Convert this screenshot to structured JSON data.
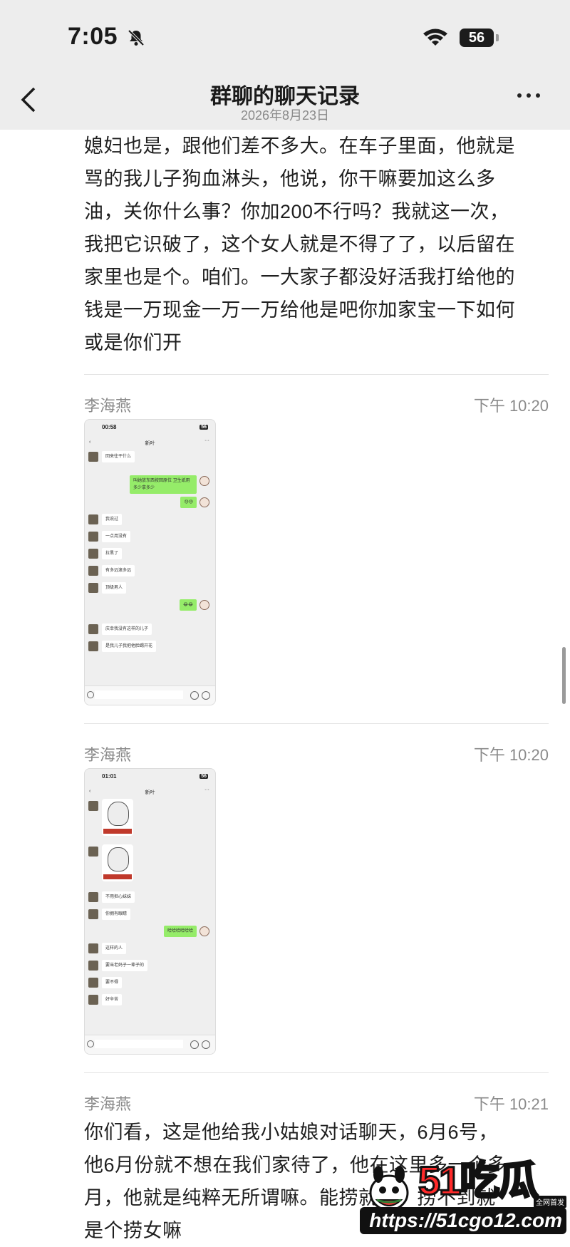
{
  "status": {
    "time": "7:05",
    "battery": "56"
  },
  "nav": {
    "title": "群聊的聊天记录",
    "date": "2026年8月23日"
  },
  "messages": [
    {
      "text_lines": [
        "媳妇也是，跟他们差不多大。在车子里面，他就是",
        "骂的我儿子狗血淋头，他说，你干嘛要加这么多",
        "油，关你什么事？你加200不行吗？我就这一次，",
        "我把它识破了，这个女人就是不得了了，以后留在",
        "家里也是个。咱们。一大家子都没好活我打给他的",
        "钱是一万现金一万一万给他是吧你加家宝一下如何",
        "或是你们开"
      ]
    },
    {
      "sender": "李海燕",
      "time": "下午 10:20",
      "shot": {
        "time": "00:58",
        "title": "新叶",
        "bubbles": [
          {
            "side": "l",
            "text": "回来往干什么"
          },
          {
            "side": "r",
            "text": "叫她放东西按回原位 卫生纸用多少拿多少"
          },
          {
            "side": "r",
            "text": "😓😓"
          },
          {
            "side": "l",
            "text": "我说过"
          },
          {
            "side": "l",
            "text": "一点用没有"
          },
          {
            "side": "l",
            "text": "拉黑了"
          },
          {
            "side": "l",
            "text": "有多远滚多远"
          },
          {
            "side": "l",
            "text": "顶级男人"
          },
          {
            "side": "r",
            "text": "😂😂"
          },
          {
            "side": "l",
            "text": "庆幸我没有这样的儿子"
          },
          {
            "side": "l",
            "text": "是我儿子我把他脸踢开花"
          }
        ]
      }
    },
    {
      "sender": "李海燕",
      "time": "下午 10:20",
      "shot": {
        "time": "01:01",
        "title": "新叶",
        "bubbles": [
          {
            "side": "l",
            "text": "不用担心妹妹"
          },
          {
            "side": "l",
            "text": "你拥有眼睛"
          },
          {
            "side": "r",
            "text": "哈哈哈哈哈哈"
          },
          {
            "side": "l",
            "text": "这样的人"
          },
          {
            "side": "l",
            "text": "要当老妈子一辈子的"
          },
          {
            "side": "l",
            "text": "要不得"
          },
          {
            "side": "l",
            "text": "好辛苦"
          }
        ]
      }
    },
    {
      "sender": "李海燕",
      "time": "下午 10:21",
      "text_lines": [
        "你们看，这是他给我小姑娘对话聊天，6月6号，",
        "他6月份就不想在我们家待了，他在这里多一个多",
        "月，他就是纯粹无所谓嘛。能捞就捞，捞不到就",
        "是个捞女嘛"
      ]
    }
  ],
  "watermark": {
    "logo_num": "51",
    "logo_text": "吃瓜",
    "badge": "全网首发",
    "url": "https://51cgo12.com"
  }
}
